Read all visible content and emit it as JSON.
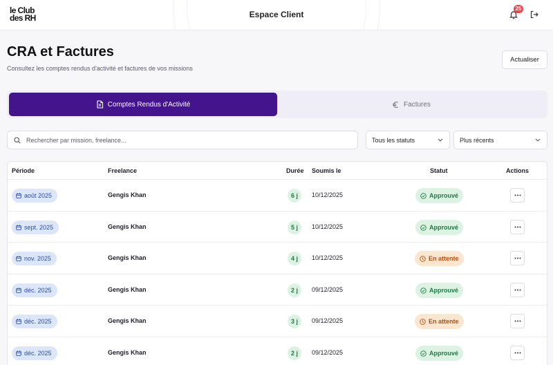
{
  "header": {
    "logo_line1": "le Club",
    "logo_line2": "des RH",
    "title": "Espace Client",
    "notification_count": "25"
  },
  "page": {
    "title": "CRA et Factures",
    "subtitle": "Consultez les comptes rendus d'activité et factures de vos missions",
    "refresh_label": "Actualiser"
  },
  "tabs": [
    {
      "label": "Comptes Rendus d'Activité",
      "icon": "document-icon",
      "active": true
    },
    {
      "label": "Factures",
      "icon": "euro-icon",
      "active": false
    }
  ],
  "filters": {
    "search_placeholder": "Rechercher par mission, freelance...",
    "status_value": "Tous les statuts",
    "sort_value": "Plus récents"
  },
  "table": {
    "headers": {
      "period": "Période",
      "freelance": "Freelance",
      "duration": "Durée",
      "submitted": "Soumis le",
      "status": "Statut",
      "actions": "Actions"
    },
    "rows": [
      {
        "period": "août 2025",
        "freelance": "Gengis Khan",
        "duration": "6 j",
        "submitted": "10/12/2025",
        "status": "Approuvé",
        "status_kind": "approved"
      },
      {
        "period": "sept. 2025",
        "freelance": "Gengis Khan",
        "duration": "5 j",
        "submitted": "10/12/2025",
        "status": "Approuvé",
        "status_kind": "approved"
      },
      {
        "period": "nov. 2025",
        "freelance": "Gengis Khan",
        "duration": "4 j",
        "submitted": "10/12/2025",
        "status": "En attente",
        "status_kind": "pending"
      },
      {
        "period": "déc. 2025",
        "freelance": "Gengis Khan",
        "duration": "2 j",
        "submitted": "09/12/2025",
        "status": "Approuvé",
        "status_kind": "approved"
      },
      {
        "period": "déc. 2025",
        "freelance": "Gengis Khan",
        "duration": "3 j",
        "submitted": "09/12/2025",
        "status": "En attente",
        "status_kind": "pending"
      },
      {
        "period": "déc. 2025",
        "freelance": "Gengis Khan",
        "duration": "2 j",
        "submitted": "09/12/2025",
        "status": "Approuvé",
        "status_kind": "approved"
      }
    ]
  },
  "colors": {
    "brand": "#43148c",
    "approved_bg": "#dcf3e4",
    "approved_text": "#1e7a45",
    "pending_bg": "#fde6cf",
    "pending_text": "#b2500f",
    "period_bg": "#dce6fb"
  }
}
